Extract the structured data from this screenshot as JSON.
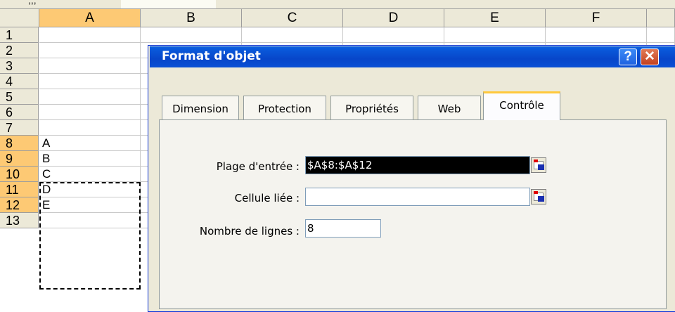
{
  "spreadsheet": {
    "top_fragment": ",,,",
    "columns": [
      "A",
      "B",
      "C",
      "D",
      "E",
      "F"
    ],
    "rows": [
      "1",
      "2",
      "3",
      "4",
      "5",
      "6",
      "7",
      "8",
      "9",
      "10",
      "11",
      "12",
      "13"
    ],
    "column_a_values": [
      "",
      "",
      "",
      "",
      "",
      "",
      "",
      "A",
      "B",
      "C",
      "D",
      "E",
      ""
    ]
  },
  "dialog": {
    "title": "Format d'objet",
    "help_label": "?",
    "close_label": "✕",
    "tabs": [
      "Dimension",
      "Protection",
      "Propriétés",
      "Web",
      "Contrôle"
    ],
    "active_tab": "Contrôle",
    "fields": {
      "input_range_label": "Plage d'entrée :",
      "input_range_value": "$A$8:$A$12",
      "linked_cell_label": "Cellule liée :",
      "linked_cell_value": "",
      "lines_label": "Nombre de lignes :",
      "lines_value": "8"
    }
  },
  "colors": {
    "title_bar": "#0a50d5",
    "dialog_bg": "#ece9d8",
    "active_tab_accent": "#ffc83c",
    "selected_header": "#fdc974"
  }
}
